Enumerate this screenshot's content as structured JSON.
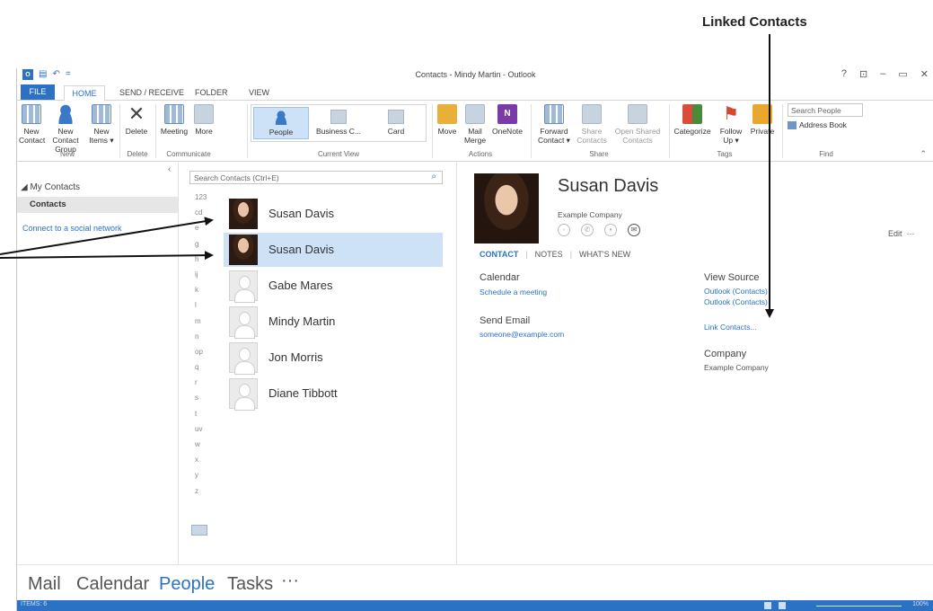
{
  "annotation": {
    "linked_contacts_label": "Linked Contacts"
  },
  "window": {
    "title": "Contacts - Mindy Martin - Outlook",
    "controls": [
      "?",
      "⊡",
      "–",
      "▭",
      "✕"
    ]
  },
  "tabs": [
    "FILE",
    "HOME",
    "SEND / RECEIVE",
    "FOLDER",
    "VIEW"
  ],
  "ribbon": {
    "new_contact": "New Contact",
    "new_contact_group": "New Contact Group",
    "new_items": "New Items ▾",
    "group_new": "New",
    "delete": "Delete",
    "group_delete": "Delete",
    "meeting": "Meeting",
    "more": "More",
    "group_communicate": "Communicate",
    "people": "People",
    "business_card": "Business C...",
    "card": "Card",
    "group_current_view": "Current View",
    "move": "Move",
    "mail_merge": "Mail Merge",
    "onenote": "OneNote",
    "group_actions": "Actions",
    "forward_contact": "Forward Contact ▾",
    "share_contacts": "Share Contacts",
    "open_shared_contacts": "Open Shared Contacts",
    "group_share": "Share",
    "categorize": "Categorize",
    "follow_up": "Follow Up ▾",
    "private": "Private",
    "group_tags": "Tags",
    "search_people": "Search People",
    "address_book": "Address Book",
    "group_find": "Find"
  },
  "nav": {
    "my_contacts": "◢ My Contacts",
    "contacts": "Contacts",
    "connect_social": "Connect to a social network"
  },
  "list": {
    "search_placeholder": "Search Contacts (Ctrl+E)",
    "alphabet": [
      "123",
      "cd",
      "e",
      "g",
      "h",
      "ij",
      "k",
      "l",
      "m",
      "n",
      "op",
      "q",
      "r",
      "s",
      "t",
      "uv",
      "w",
      "x",
      "y",
      "z"
    ],
    "contacts": [
      {
        "name": "Susan Davis",
        "has_photo": true
      },
      {
        "name": "Susan Davis",
        "has_photo": true,
        "selected": true
      },
      {
        "name": "Gabe Mares",
        "has_photo": false
      },
      {
        "name": "Mindy Martin",
        "has_photo": false
      },
      {
        "name": "Jon Morris",
        "has_photo": false
      },
      {
        "name": "Diane Tibbott",
        "has_photo": false
      }
    ]
  },
  "reading": {
    "full_name": "Susan Davis",
    "company": "Example Company",
    "edit": "Edit",
    "more": "···",
    "tabs": {
      "contact": "CONTACT",
      "notes": "NOTES",
      "whats_new": "WHAT'S NEW"
    },
    "calendar_title": "Calendar",
    "schedule_meeting": "Schedule a meeting",
    "send_email_title": "Send Email",
    "email": "someone@example.com",
    "view_source_title": "View Source",
    "source_1": "Outlook (Contacts)",
    "source_2": "Outlook (Contacts)",
    "link_contacts": "Link Contacts...",
    "company_title": "Company",
    "company_value": "Example Company"
  },
  "bottom_nav": {
    "mail": "Mail",
    "calendar": "Calendar",
    "people": "People",
    "tasks": "Tasks",
    "more": "···"
  },
  "status": {
    "items": "ITEMS: 6",
    "zoom": "100%"
  },
  "colors": {
    "accent": "#2b72c4",
    "selected_row": "#cde2f7",
    "status_bar": "#2b72c4"
  }
}
